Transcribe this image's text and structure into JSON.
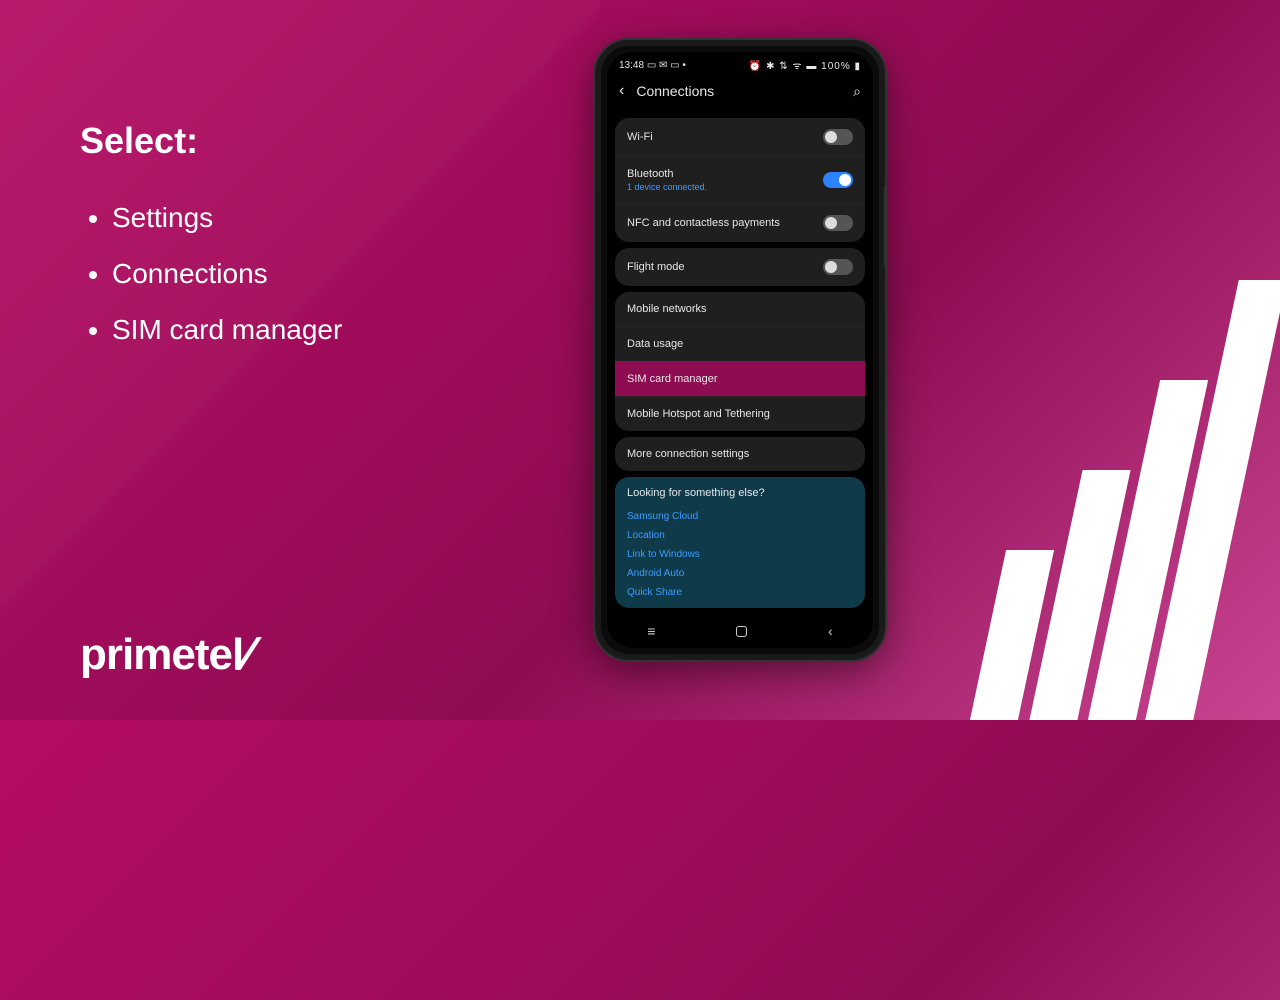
{
  "instructions": {
    "heading": "Select:",
    "items": [
      "Settings",
      "Connections",
      "SIM card manager"
    ]
  },
  "brand": {
    "name": "primetel"
  },
  "phone": {
    "status": {
      "time": "13:48",
      "left_icons": "▭ ✉ ▭ •",
      "right_icons": "⏰ ✱ ⇅ ᯤ ▬ 100% ▮"
    },
    "header": {
      "title": "Connections"
    },
    "rows": {
      "wifi": {
        "label": "Wi-Fi",
        "on": false
      },
      "bluetooth": {
        "label": "Bluetooth",
        "sub": "1 device connected.",
        "on": true
      },
      "nfc": {
        "label": "NFC and contactless payments",
        "on": false
      },
      "flight": {
        "label": "Flight mode",
        "on": false
      },
      "mobile": {
        "label": "Mobile networks"
      },
      "data": {
        "label": "Data usage"
      },
      "sim": {
        "label": "SIM card manager"
      },
      "hotspot": {
        "label": "Mobile Hotspot and Tethering"
      },
      "more": {
        "label": "More connection settings"
      }
    },
    "suggest": {
      "head": "Looking for something else?",
      "links": [
        "Samsung Cloud",
        "Location",
        "Link to Windows",
        "Android Auto",
        "Quick Share"
      ]
    }
  }
}
